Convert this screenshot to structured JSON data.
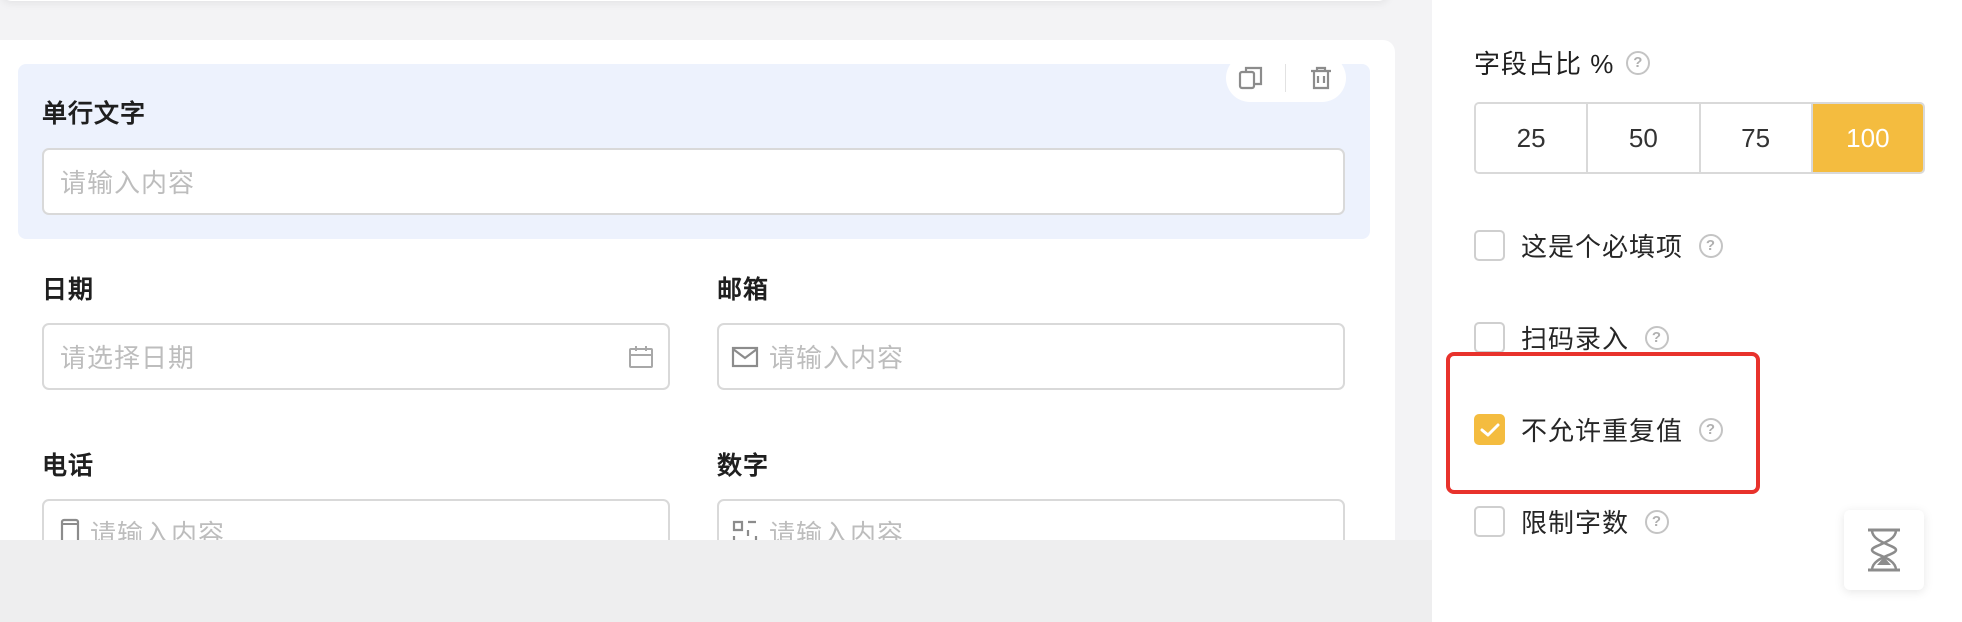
{
  "form": {
    "single_text": {
      "label": "单行文字",
      "placeholder": "请输入内容"
    },
    "date": {
      "label": "日期",
      "placeholder": "请选择日期"
    },
    "email": {
      "label": "邮箱",
      "placeholder": "请输入内容"
    },
    "phone": {
      "label": "电话",
      "placeholder": "请输入内容"
    },
    "number": {
      "label": "数字",
      "placeholder": "请输入内容"
    }
  },
  "actions": {
    "copy_icon": "copy-icon",
    "delete_icon": "trash-icon"
  },
  "settings": {
    "width_title": "字段占比 %",
    "width_options": [
      "25",
      "50",
      "75",
      "100"
    ],
    "width_selected": "100",
    "options": [
      {
        "label": "这是个必填项",
        "checked": false
      },
      {
        "label": "扫码录入",
        "checked": false
      },
      {
        "label": "不允许重复值",
        "checked": true
      },
      {
        "label": "限制字数",
        "checked": false
      }
    ],
    "help_glyph": "?"
  },
  "colors": {
    "accent": "#f4bc3f",
    "highlight": "#e8322c",
    "selected_bg": "#edf2fd"
  }
}
